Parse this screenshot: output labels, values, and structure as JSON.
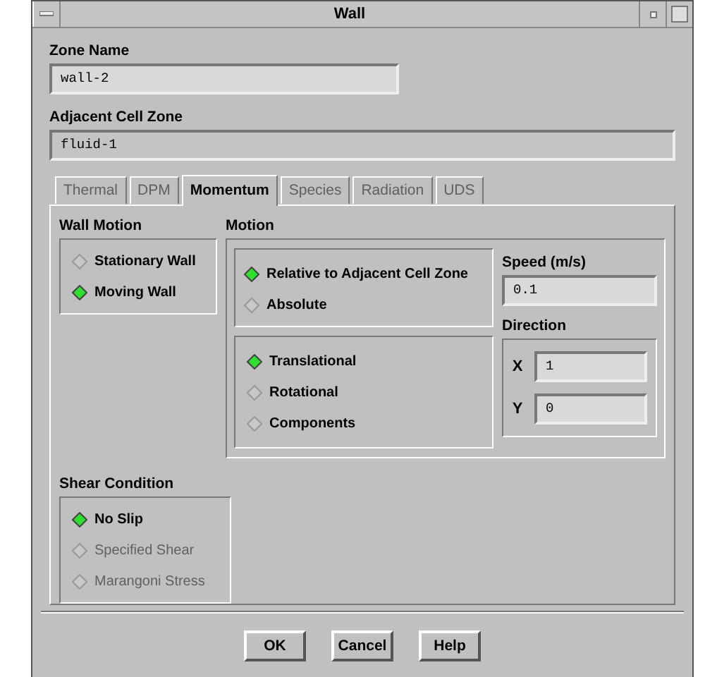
{
  "window": {
    "title": "Wall"
  },
  "zone_name": {
    "label": "Zone Name",
    "value": "wall-2"
  },
  "adjacent_cell_zone": {
    "label": "Adjacent Cell Zone",
    "value": "fluid-1"
  },
  "tabs": [
    {
      "label": "Thermal",
      "selected": false,
      "disabled": true
    },
    {
      "label": "DPM",
      "selected": false,
      "disabled": true
    },
    {
      "label": "Momentum",
      "selected": true,
      "disabled": false
    },
    {
      "label": "Species",
      "selected": false,
      "disabled": true
    },
    {
      "label": "Radiation",
      "selected": false,
      "disabled": true
    },
    {
      "label": "UDS",
      "selected": false,
      "disabled": true
    }
  ],
  "wall_motion": {
    "label": "Wall Motion",
    "options": [
      {
        "label": "Stationary Wall",
        "selected": false,
        "disabled": false
      },
      {
        "label": "Moving Wall",
        "selected": true,
        "disabled": false
      }
    ]
  },
  "motion": {
    "label": "Motion",
    "reference": [
      {
        "label": "Relative to Adjacent Cell Zone",
        "selected": true,
        "disabled": false
      },
      {
        "label": "Absolute",
        "selected": false,
        "disabled": false
      }
    ],
    "type": [
      {
        "label": "Translational",
        "selected": true,
        "disabled": false
      },
      {
        "label": "Rotational",
        "selected": false,
        "disabled": false
      },
      {
        "label": "Components",
        "selected": false,
        "disabled": false
      }
    ],
    "speed": {
      "label": "Speed (m/s)",
      "value": "0.1"
    },
    "direction": {
      "label": "Direction",
      "components": [
        {
          "label": "X",
          "value": "1"
        },
        {
          "label": "Y",
          "value": "0"
        }
      ]
    }
  },
  "shear_condition": {
    "label": "Shear Condition",
    "options": [
      {
        "label": "No Slip",
        "selected": true,
        "disabled": false
      },
      {
        "label": "Specified Shear",
        "selected": false,
        "disabled": true
      },
      {
        "label": "Marangoni Stress",
        "selected": false,
        "disabled": true
      }
    ]
  },
  "buttons": [
    "OK",
    "Cancel",
    "Help"
  ]
}
